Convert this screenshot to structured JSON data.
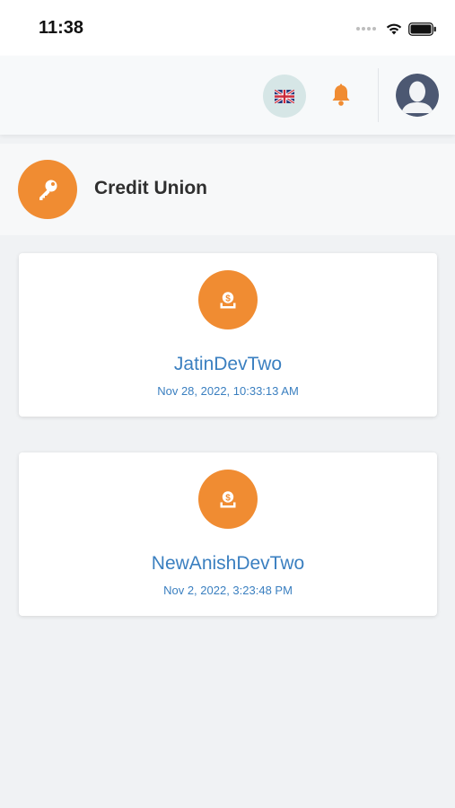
{
  "status_bar": {
    "time": "11:38"
  },
  "header": {
    "language_icon": "uk-flag-icon",
    "notification_icon": "bell-icon",
    "avatar_icon": "user-avatar-icon"
  },
  "section": {
    "title": "Credit Union",
    "icon": "key-icon"
  },
  "cards": [
    {
      "name": "JatinDevTwo",
      "date": "Nov 28, 2022, 10:33:13 AM",
      "icon": "money-deposit-icon"
    },
    {
      "name": "NewAnishDevTwo",
      "date": "Nov 2, 2022, 3:23:48 PM",
      "icon": "money-deposit-icon"
    }
  ],
  "colors": {
    "accent": "#f08c32",
    "link": "#3a7fc0",
    "background": "#f0f2f4"
  }
}
